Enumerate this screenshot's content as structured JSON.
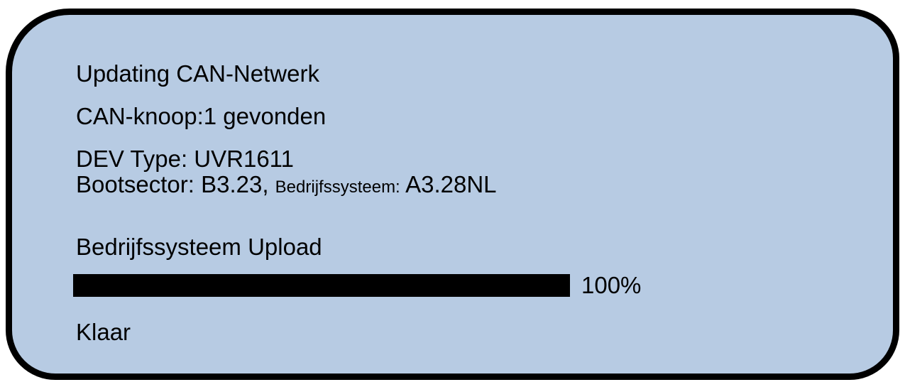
{
  "status_screen": {
    "title": "Updating CAN-Netwerk",
    "can_node_found": "CAN-knoop:1 gevonden",
    "device_type": "DEV Type: UVR1611",
    "bootsector_label": "Bootsector: B3.23,",
    "os_label": "Bedrijfssysteem:",
    "os_version": "A3.28NL",
    "upload_title": "Bedrijfssysteem Upload",
    "progress": {
      "value": 1.0,
      "label": "100%"
    },
    "done_text": "Klaar"
  },
  "colors": {
    "background": "#b7cbe3",
    "border": "#000000",
    "progress_fill": "#000000"
  }
}
